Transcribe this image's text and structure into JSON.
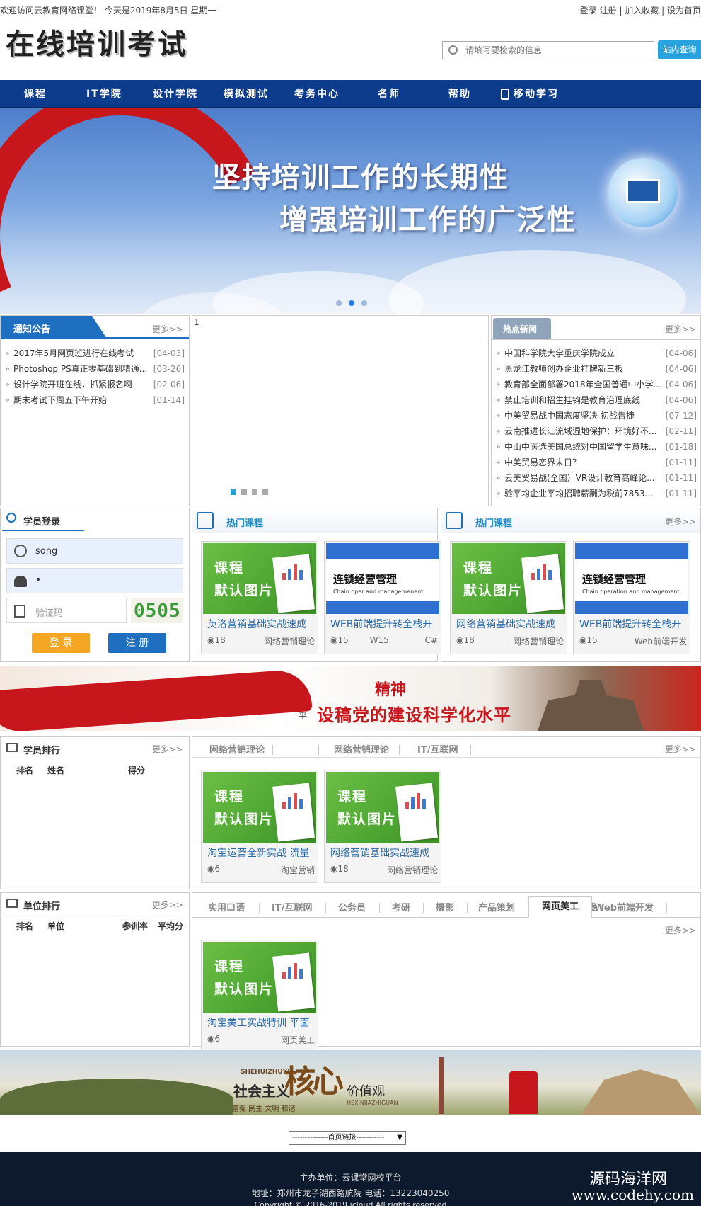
{
  "topbar": {
    "welcome": "欢迎访问云教育网络课堂！ 今天是2019年8月5日 星期一",
    "login": "登录",
    "register": "注册",
    "favorite": "加入收藏",
    "homepage": "设为首页"
  },
  "logo": {
    "text": "在线培训考试"
  },
  "search": {
    "placeholder": "请填写要检索的信息",
    "button": "站内查询"
  },
  "nav": {
    "items": [
      "课程",
      "IT学院",
      "设计学院",
      "模拟测试",
      "考务中心",
      "名师",
      "帮助",
      "移动学习"
    ]
  },
  "banner": {
    "line1": "坚持培训工作的长期性",
    "line2": "增强培训工作的广泛性"
  },
  "notice": {
    "title": "通知公告",
    "more": "更多>>",
    "items": [
      {
        "text": "2017年5月网页班进行在线考试",
        "date": "[04-03]"
      },
      {
        "text": "Photoshop PS真正零基础到精通...",
        "date": "[03-26]"
      },
      {
        "text": "设计学院开班在线，抓紧报名啊",
        "date": "[02-06]"
      },
      {
        "text": "期末考试下周五下午开始",
        "date": "[01-14]"
      }
    ]
  },
  "slider": {
    "alt": "1"
  },
  "hotnews": {
    "title": "热点新闻",
    "more": "更多>>",
    "items": [
      {
        "text": "中国科学院大学重庆学院成立",
        "date": "[04-06]"
      },
      {
        "text": "黑龙江教师创办企业挂牌新三板",
        "date": "[04-06]"
      },
      {
        "text": "教育部全面部署2018年全国普通中小学...",
        "date": "[04-06]"
      },
      {
        "text": "禁止培训和招生挂钩是教育治理底线",
        "date": "[04-06]"
      },
      {
        "text": "中美贸易战中国态度坚决 初战告捷",
        "date": "[07-12]"
      },
      {
        "text": "云南推进长江流域湿地保护：环境好不...",
        "date": "[02-11]"
      },
      {
        "text": "中山中医选美国总统对中国留学生意味...",
        "date": "[01-18]"
      },
      {
        "text": "中美贸易恋界末日？",
        "date": "[01-11]"
      },
      {
        "text": "云美贸易战(全国）VR设计教育高峰论...",
        "date": "[01-11]"
      },
      {
        "text": "验平均企业平均招聘薪酬为税前7853...",
        "date": "[01-11]"
      }
    ]
  },
  "login": {
    "title": "学员登录",
    "username": "song",
    "password": "•",
    "captcha_placeholder": "验证码",
    "captcha": "0505",
    "login_btn": "登 录",
    "register_btn": "注 册"
  },
  "hot1": {
    "title": "热门课程",
    "cards": [
      {
        "img": "default",
        "t1": "课程",
        "t2": "默认图片",
        "name": "英洛营销基础实战速成",
        "views": "18",
        "cat": "网络营销理论"
      },
      {
        "img": "mgmt",
        "t1": "连锁经营管理",
        "t2": "Chain oper and managemenent",
        "name": "WEB前端提升转全栈开",
        "views": "15",
        "cat": "W15",
        "extra": "C#"
      }
    ]
  },
  "hot2": {
    "title": "热门课程",
    "more": "更多>>",
    "cards": [
      {
        "img": "default",
        "t1": "课程",
        "t2": "默认图片",
        "name": "网络营销基础实战速成",
        "views": "18",
        "cat": "网络营销理论"
      },
      {
        "img": "mgmt",
        "t1": "连锁经营管理",
        "t2": "Chain operation and management",
        "name": "WEB前端提升转全栈开",
        "views": "15",
        "cat": "Web前端开发"
      }
    ]
  },
  "banner2": {
    "text1": "精神",
    "text2": "设稿党的建设科学化水平",
    "small": "平"
  },
  "rank": {
    "title": "学员排行",
    "more": "更多>>",
    "cols": [
      "排名",
      "姓名",
      "得分"
    ]
  },
  "tabs1": {
    "items": [
      "网络营销理论",
      "",
      "网络营销理论",
      "IT/互联网"
    ],
    "more": "更多>>",
    "cards": [
      {
        "img": "default",
        "t1": "课程",
        "t2": "默认图片",
        "name": "淘宝运营全新实战 流量",
        "views": "6",
        "cat": "淘宝营销"
      },
      {
        "img": "default",
        "t1": "课程",
        "t2": "默认图片",
        "name": "网络营销基础实战速成",
        "views": "18",
        "cat": "网络营销理论"
      }
    ]
  },
  "unitrank": {
    "title": "单位排行",
    "more": "更多>>",
    "cols": [
      "排名",
      "单位",
      "参训率",
      "平均分"
    ]
  },
  "tabs2": {
    "items": [
      "实用口语",
      "IT/互联网",
      "公务员",
      "考研",
      "摄影",
      "产品策划",
      "网页美工",
      "Web前端开发"
    ],
    "active": 6,
    "more": "更多>>",
    "cards": [
      {
        "img": "default",
        "t1": "课程",
        "t2": "默认图片",
        "name": "淘宝美工实战特训 平面",
        "views": "6",
        "cat": "网页美工"
      }
    ]
  },
  "banner3": {
    "py1": "SHEHUIZHUYI",
    "cn1": "社会主义",
    "big": "核心",
    "cn2": "价值观",
    "py2": "HEXINJIAZHIGUAN",
    "sub": "富强 民主 文明 和谐"
  },
  "links": {
    "label": "--------------首页链接-----------"
  },
  "footer": {
    "l1": "主办单位：云课堂网校平台",
    "l2": "地址：郑州市龙子湖西路航院    电话：13223040250",
    "l3": "Copyright © 2016-2019 icloud All rights reserved",
    "wm1": "源码海洋网",
    "wm2": "www.codehy.com"
  },
  "colors": {
    "nav": "#0d3c8c",
    "accent": "#29a3e0",
    "login": "#f5a623",
    "register": "#1f6fc0"
  }
}
